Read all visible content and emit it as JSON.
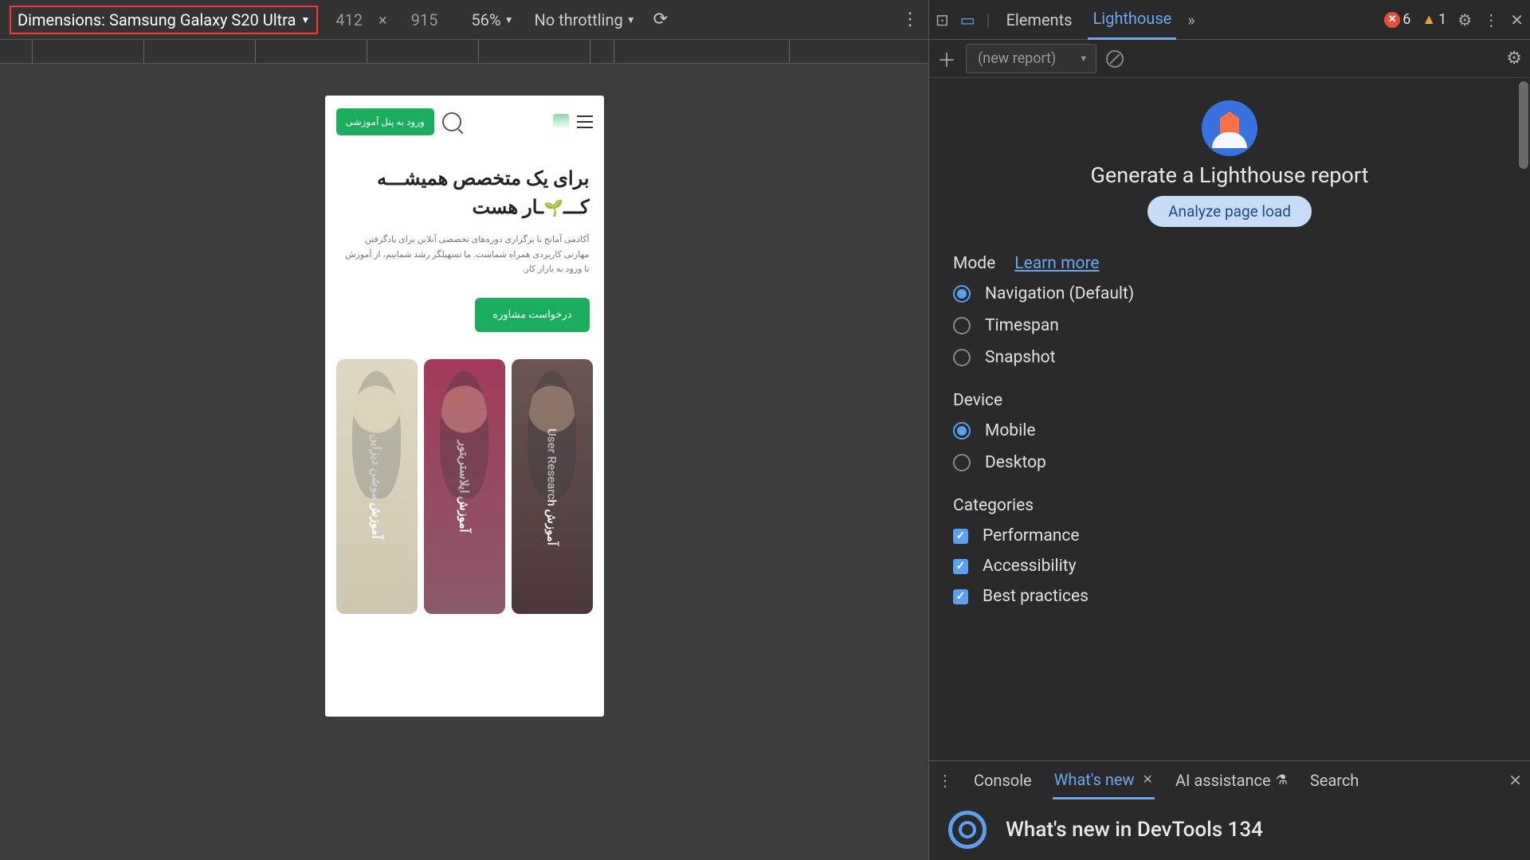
{
  "deviceToolbar": {
    "dimensionsLabel": "Dimensions: Samsung Galaxy S20 Ultra",
    "width": "412",
    "height": "915",
    "zoom": "56%",
    "throttle": "No throttling"
  },
  "phone": {
    "loginBtn": "ورود به پنل آموزشی",
    "heroTitle1": "برای یک متخصص همیشـــه",
    "heroTitle2a": "کـــ",
    "heroTitle2b": "ـار هست",
    "heroDesc": "آکادمی آمانج با برگزاری دوره‌های تخصصی آنلاین برای یادگرفتن مهارتی کاربردی همراه شماست. ما تسهیلگر رشد شماییم، از آموزش تا ورود به بازار کار.",
    "consultBtn": "درخواست مشاوره",
    "cards": [
      "آموزش User Research",
      "آموزش ایلاستریتور",
      "آموزش موشن دیزاین"
    ]
  },
  "devtools": {
    "tabs": {
      "elements": "Elements",
      "lighthouse": "Lighthouse"
    },
    "errors": "6",
    "warnings": "1"
  },
  "lighthouse": {
    "newReport": "(new report)",
    "title": "Generate a Lighthouse report",
    "cta": "Analyze page load",
    "modeLabel": "Mode",
    "learnMore": "Learn more",
    "modes": {
      "navigation": "Navigation (Default)",
      "timespan": "Timespan",
      "snapshot": "Snapshot"
    },
    "deviceLabel": "Device",
    "devices": {
      "mobile": "Mobile",
      "desktop": "Desktop"
    },
    "categoriesLabel": "Categories",
    "categories": {
      "performance": "Performance",
      "accessibility": "Accessibility",
      "bestPractices": "Best practices"
    }
  },
  "drawer": {
    "tabs": {
      "console": "Console",
      "whatsNew": "What's new",
      "aiAssist": "AI assistance",
      "search": "Search"
    },
    "contentTitle": "What's new in DevTools 134"
  }
}
